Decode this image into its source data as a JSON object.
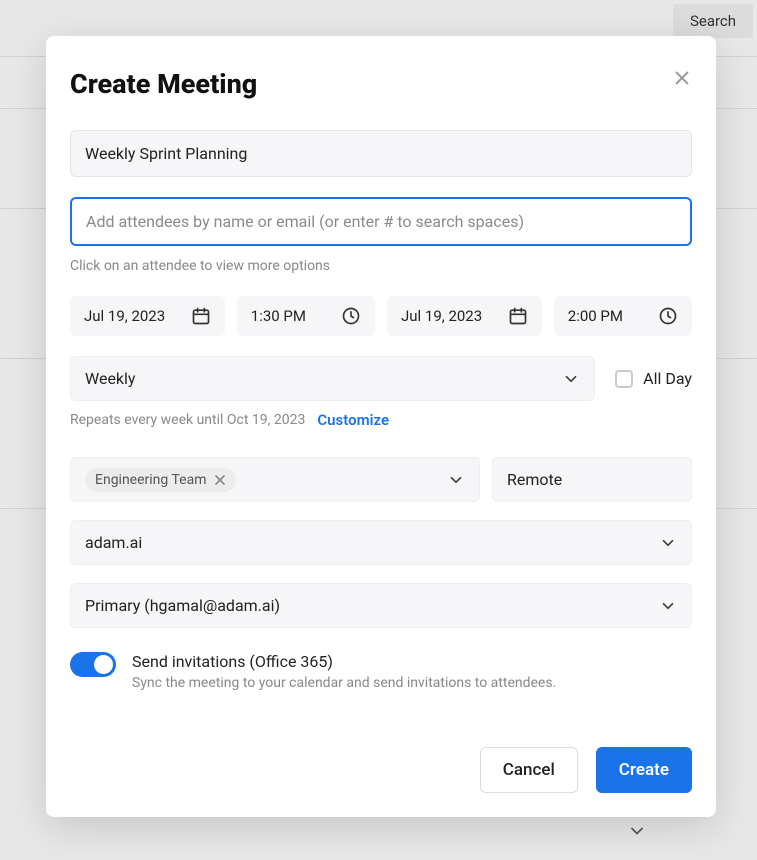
{
  "background": {
    "search_label": "Search"
  },
  "modal": {
    "title": "Create Meeting",
    "name_value": "Weekly Sprint Planning",
    "attendees_placeholder": "Add attendees by name or email (or enter # to search spaces)",
    "attendees_helper": "Click on an attendee to view more options",
    "start_date": "Jul 19, 2023",
    "start_time": "1:30 PM",
    "end_date": "Jul 19, 2023",
    "end_time": "2:00 PM",
    "recurrence": "Weekly",
    "all_day_label": "All Day",
    "repeats_text": "Repeats every week until Oct 19, 2023",
    "customize_label": "Customize",
    "team_tag": "Engineering Team",
    "location_value": "Remote",
    "workspace": "adam.ai",
    "calendar": "Primary (hgamal@adam.ai)",
    "toggle": {
      "title": "Send invitations (Office 365)",
      "description": "Sync the meeting to your calendar and send invitations to attendees."
    },
    "cancel_label": "Cancel",
    "create_label": "Create"
  }
}
